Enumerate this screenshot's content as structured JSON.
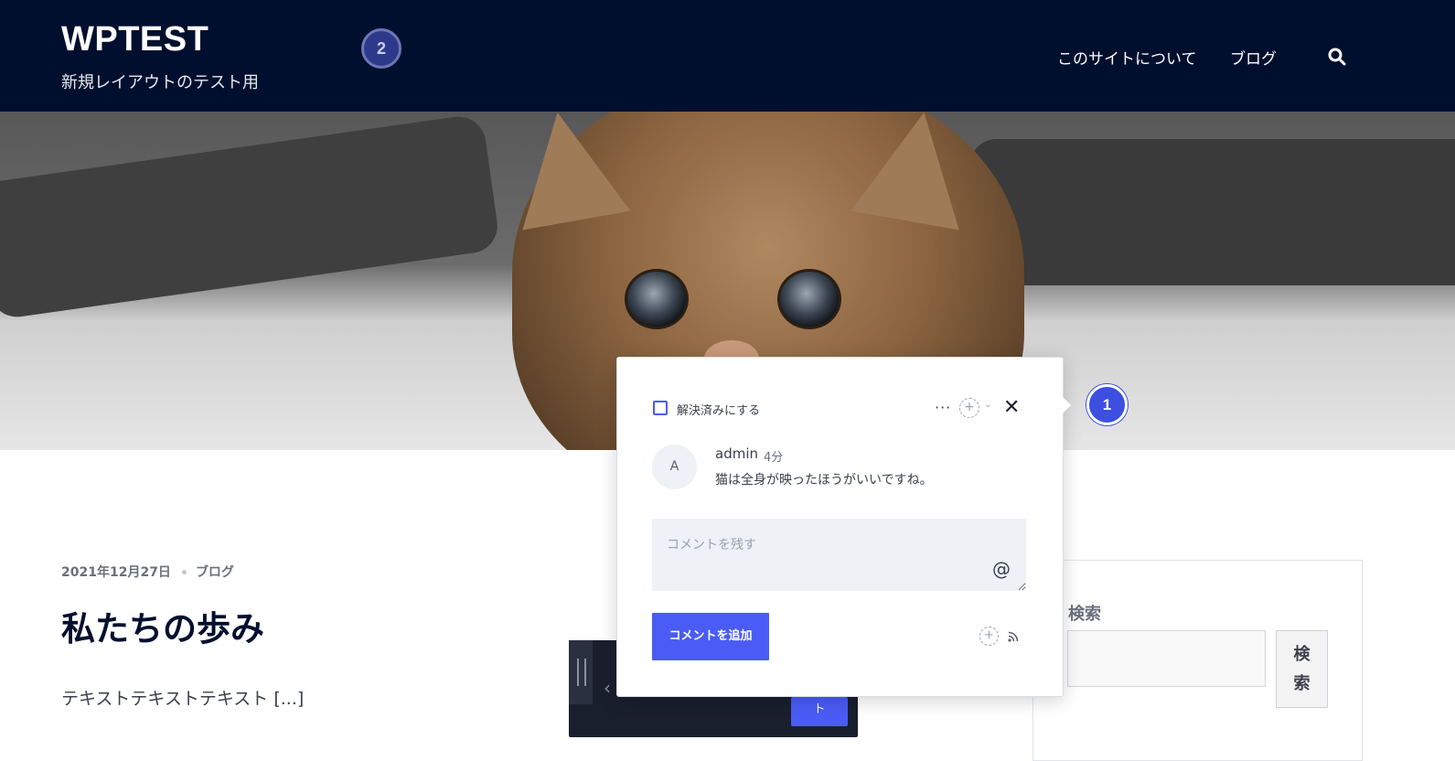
{
  "header": {
    "site_title": "WPTEST",
    "site_tagline": "新規レイアウトのテスト用",
    "marker_label": "2",
    "nav": [
      {
        "label": "このサイトについて"
      },
      {
        "label": "ブログ"
      }
    ],
    "search_icon": "search-icon",
    "background_color": "#000f2e"
  },
  "post": {
    "date": "2021年12月27日",
    "category": "ブログ",
    "title": "私たちの歩み",
    "excerpt": "テキストテキストテキスト [...]"
  },
  "sidebar": {
    "widget_title": "検索",
    "search_value": "",
    "search_button": "検\n索"
  },
  "toolbar": {
    "chevron_icon": "chevron-left-icon",
    "button_label": "ト"
  },
  "comment_popover": {
    "resolve_label": "解決済みにする",
    "more_icon": "ellipsis-icon",
    "add_reaction_icon": "add-reaction-icon",
    "close_icon": "close-icon",
    "avatar_initial": "A",
    "author": "admin",
    "time": "4分",
    "text": "猫は全身が映ったほうがいいですね。",
    "input_placeholder": "コメントを残す",
    "input_value": "",
    "mention_icon": "at-icon",
    "submit_label": "コメントを追加",
    "feed_icon": "rss-icon",
    "marker_label": "1",
    "accent_color": "#4a5cf5"
  }
}
